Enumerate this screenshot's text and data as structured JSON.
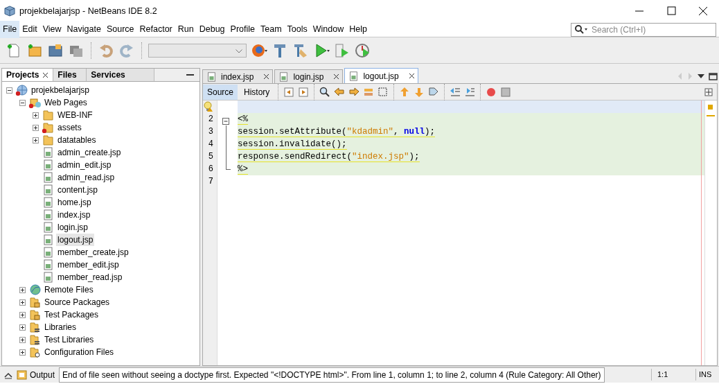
{
  "window": {
    "title": "projekbelajarjsp - NetBeans IDE 8.2"
  },
  "menu": [
    {
      "label": "File",
      "selected": true
    },
    {
      "label": "Edit",
      "selected": false
    },
    {
      "label": "View",
      "selected": false
    },
    {
      "label": "Navigate",
      "selected": false
    },
    {
      "label": "Source",
      "selected": false
    },
    {
      "label": "Refactor",
      "selected": false
    },
    {
      "label": "Run",
      "selected": false
    },
    {
      "label": "Debug",
      "selected": false
    },
    {
      "label": "Profile",
      "selected": false
    },
    {
      "label": "Team",
      "selected": false
    },
    {
      "label": "Tools",
      "selected": false
    },
    {
      "label": "Window",
      "selected": false
    },
    {
      "label": "Help",
      "selected": false
    }
  ],
  "search": {
    "placeholder": "Search (Ctrl+I)"
  },
  "left_panel": {
    "tabs": [
      {
        "label": "Projects",
        "selected": true
      },
      {
        "label": "Files",
        "selected": false
      },
      {
        "label": "Services",
        "selected": false
      }
    ],
    "tree": [
      {
        "label": "projekbelajarjsp",
        "kind": "project",
        "error": true,
        "expanded": true,
        "selected": false,
        "children": [
          {
            "label": "Web Pages",
            "kind": "webpages",
            "error": true,
            "expanded": true,
            "selected": false,
            "children": [
              {
                "label": "WEB-INF",
                "kind": "folder",
                "error": false,
                "expanded": false,
                "selected": false
              },
              {
                "label": "assets",
                "kind": "folder",
                "error": true,
                "expanded": false,
                "selected": false
              },
              {
                "label": "datatables",
                "kind": "folder",
                "error": false,
                "expanded": false,
                "selected": false
              },
              {
                "label": "admin_create.jsp",
                "kind": "jsp",
                "error": false,
                "expanded": false,
                "selected": false
              },
              {
                "label": "admin_edit.jsp",
                "kind": "jsp",
                "error": false,
                "expanded": false,
                "selected": false
              },
              {
                "label": "admin_read.jsp",
                "kind": "jsp",
                "error": false,
                "expanded": false,
                "selected": false
              },
              {
                "label": "content.jsp",
                "kind": "jsp",
                "error": false,
                "expanded": false,
                "selected": false
              },
              {
                "label": "home.jsp",
                "kind": "jsp",
                "error": false,
                "expanded": false,
                "selected": false
              },
              {
                "label": "index.jsp",
                "kind": "jsp",
                "error": false,
                "expanded": false,
                "selected": false
              },
              {
                "label": "login.jsp",
                "kind": "jsp",
                "error": false,
                "expanded": false,
                "selected": false
              },
              {
                "label": "logout.jsp",
                "kind": "jsp",
                "error": false,
                "expanded": false,
                "selected": true
              },
              {
                "label": "member_create.jsp",
                "kind": "jsp",
                "error": false,
                "expanded": false,
                "selected": false
              },
              {
                "label": "member_edit.jsp",
                "kind": "jsp",
                "error": false,
                "expanded": false,
                "selected": false
              },
              {
                "label": "member_read.jsp",
                "kind": "jsp",
                "error": false,
                "expanded": false,
                "selected": false
              }
            ]
          },
          {
            "label": "Remote Files",
            "kind": "remote",
            "error": false,
            "expanded": false,
            "selected": false
          },
          {
            "label": "Source Packages",
            "kind": "package",
            "error": false,
            "expanded": false,
            "selected": false
          },
          {
            "label": "Test Packages",
            "kind": "package",
            "error": false,
            "expanded": false,
            "selected": false
          },
          {
            "label": "Libraries",
            "kind": "library",
            "error": false,
            "expanded": false,
            "selected": false
          },
          {
            "label": "Test Libraries",
            "kind": "library",
            "error": false,
            "expanded": false,
            "selected": false
          },
          {
            "label": "Configuration Files",
            "kind": "config",
            "error": false,
            "expanded": false,
            "selected": false
          }
        ]
      }
    ]
  },
  "editor": {
    "tabs": [
      {
        "label": "index.jsp",
        "selected": false
      },
      {
        "label": "login.jsp",
        "selected": false
      },
      {
        "label": "logout.jsp",
        "selected": true
      }
    ],
    "modes": [
      {
        "label": "Source",
        "selected": true
      },
      {
        "label": "History",
        "selected": false
      }
    ],
    "lines": [
      {
        "hint": true,
        "current": true,
        "highlighted": false,
        "kind": "plain"
      },
      {
        "number": "2",
        "hint": false,
        "current": false,
        "highlighted": true,
        "kind": "start",
        "tokens": [
          {
            "text": "<%",
            "kind": "plain"
          }
        ]
      },
      {
        "number": "3",
        "hint": false,
        "current": false,
        "highlighted": true,
        "kind": "mid",
        "tokens": [
          {
            "text": "session.setAttribute(",
            "kind": "plain"
          },
          {
            "text": "\"kdadmin\"",
            "kind": "string"
          },
          {
            "text": ", ",
            "kind": "plain"
          },
          {
            "text": "null",
            "kind": "keyword"
          },
          {
            "text": ");",
            "kind": "plain"
          }
        ]
      },
      {
        "number": "4",
        "hint": false,
        "current": false,
        "highlighted": true,
        "kind": "mid",
        "tokens": [
          {
            "text": "session.invalidate();",
            "kind": "plain"
          }
        ]
      },
      {
        "number": "5",
        "hint": false,
        "current": false,
        "highlighted": true,
        "kind": "mid",
        "tokens": [
          {
            "text": "response.sendRedirect(",
            "kind": "plain"
          },
          {
            "text": "\"index.jsp\"",
            "kind": "string"
          },
          {
            "text": ");",
            "kind": "plain"
          }
        ]
      },
      {
        "number": "6",
        "hint": false,
        "current": false,
        "highlighted": true,
        "kind": "end",
        "tokens": [
          {
            "text": "%>",
            "kind": "plain"
          }
        ]
      },
      {
        "number": "7",
        "hint": false,
        "current": false,
        "highlighted": false,
        "kind": "plain"
      }
    ]
  },
  "status_bar": {
    "output": "Output",
    "message": "End of file seen without seeing a doctype first. Expected \"<!DOCTYPE html>\". From line 1, column 1; to line 2, column 4 (Rule Category: All Other)",
    "position": "1:1",
    "mode": "INS"
  }
}
